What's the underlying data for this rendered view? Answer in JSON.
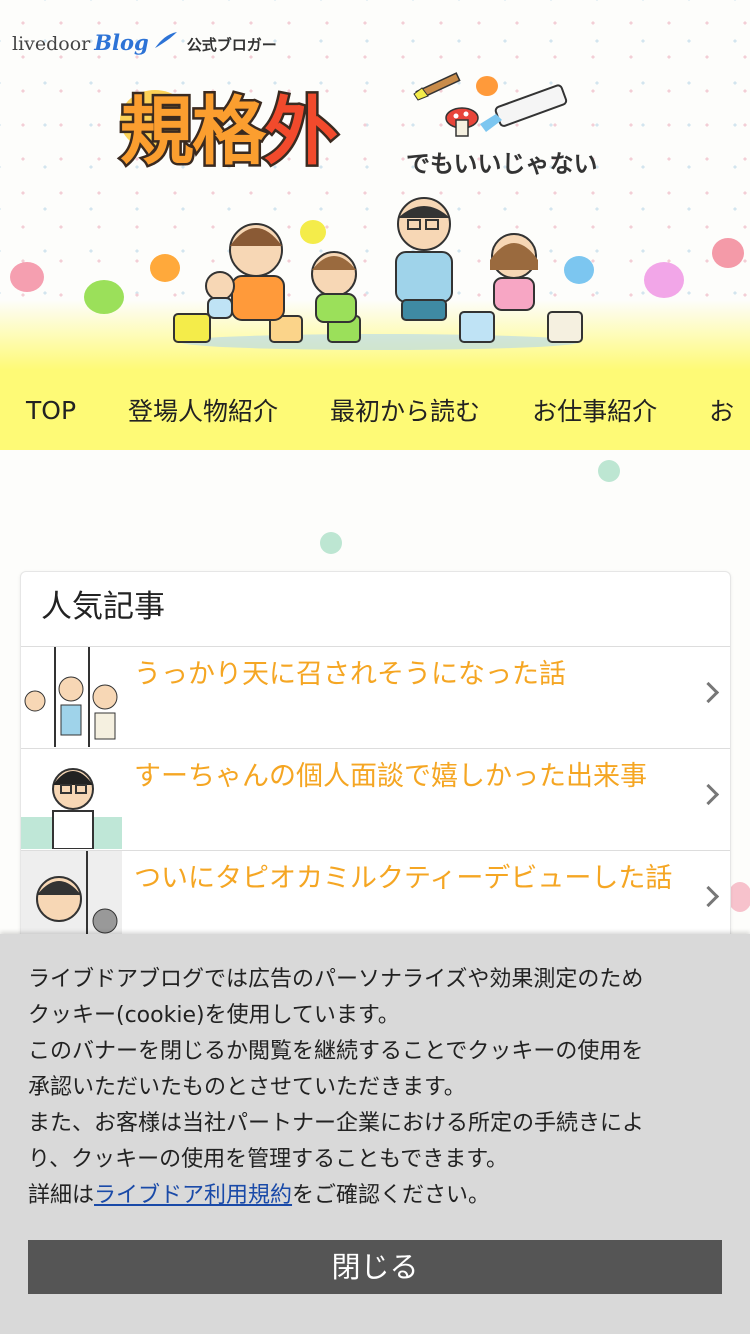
{
  "header": {
    "logo_livedoor": "livedoor",
    "logo_blog": "Blog",
    "logo_official": "公式ブロガー",
    "title_main_1": "規格",
    "title_main_2": "外",
    "title_sub": "でもいいじゃない"
  },
  "nav": {
    "items": [
      {
        "label": "TOP"
      },
      {
        "label": "登場人物紹介"
      },
      {
        "label": "最初から読む"
      },
      {
        "label": "お仕事紹介"
      },
      {
        "label": "お"
      }
    ]
  },
  "popular": {
    "title": "人気記事",
    "articles": [
      {
        "title": "うっかり天に召されそうになった話"
      },
      {
        "title": "すーちゃんの個人面談で嬉しかった出来事"
      },
      {
        "title": "ついにタピオカミルクティーデビューした話"
      }
    ]
  },
  "cookie_banner": {
    "line1": "ライブドアブログでは広告のパーソナライズや効果測定のため",
    "line2": "クッキー(cookie)を使用しています。",
    "line3": "このバナーを閉じるか閲覧を継続することでクッキーの使用を",
    "line4": "承認いただいたものとさせていただきます。",
    "line5": "また、お客様は当社パートナー企業における所定の手続きによ",
    "line6": "り、クッキーの使用を管理することもできます。",
    "details_prefix": "詳細は",
    "details_link": "ライブドア利用規約",
    "details_suffix": "をご確認ください。",
    "close_label": "閉じる"
  },
  "colors": {
    "nav_bg": "#fefa76",
    "article_link": "#f5a623",
    "banner_bg": "#d9d9d9",
    "close_button": "#555555"
  }
}
